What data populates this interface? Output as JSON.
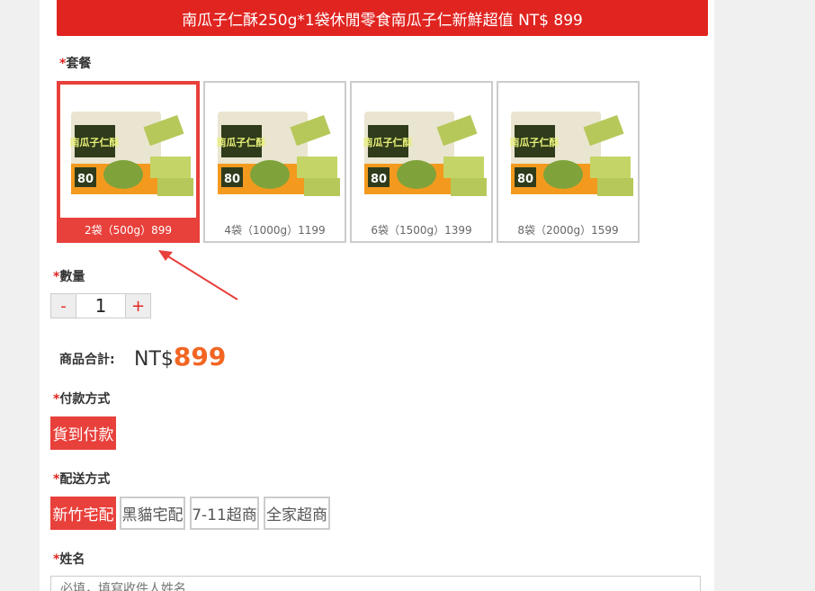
{
  "header": {
    "title": "南瓜子仁酥250g*1袋休閒零食南瓜子仁新鮮超值 NT$ 899"
  },
  "package": {
    "label": "套餐",
    "options": [
      {
        "caption": "2袋（500g）899",
        "selected": true
      },
      {
        "caption": "4袋（1000g）1199",
        "selected": false
      },
      {
        "caption": "6袋（1500g）1399",
        "selected": false
      },
      {
        "caption": "8袋（2000g）1599",
        "selected": false
      }
    ],
    "product_brand": "南瓜子仁酥",
    "product_badge": "80"
  },
  "quantity": {
    "label": "數量",
    "minus": "-",
    "value": "1",
    "plus": "+"
  },
  "total": {
    "label": "商品合計:",
    "currency": "NT$",
    "amount": "899"
  },
  "payment": {
    "label": "付款方式",
    "options": [
      "貨到付款"
    ]
  },
  "shipping": {
    "label": "配送方式",
    "options": [
      "新竹宅配",
      "黑貓宅配",
      "7-11超商",
      "全家超商"
    ]
  },
  "name": {
    "label": "姓名",
    "placeholder": "必填，填寫收件人姓名"
  },
  "required_mark": "*",
  "colors": {
    "primary": "#e02420",
    "price": "#f26522"
  }
}
